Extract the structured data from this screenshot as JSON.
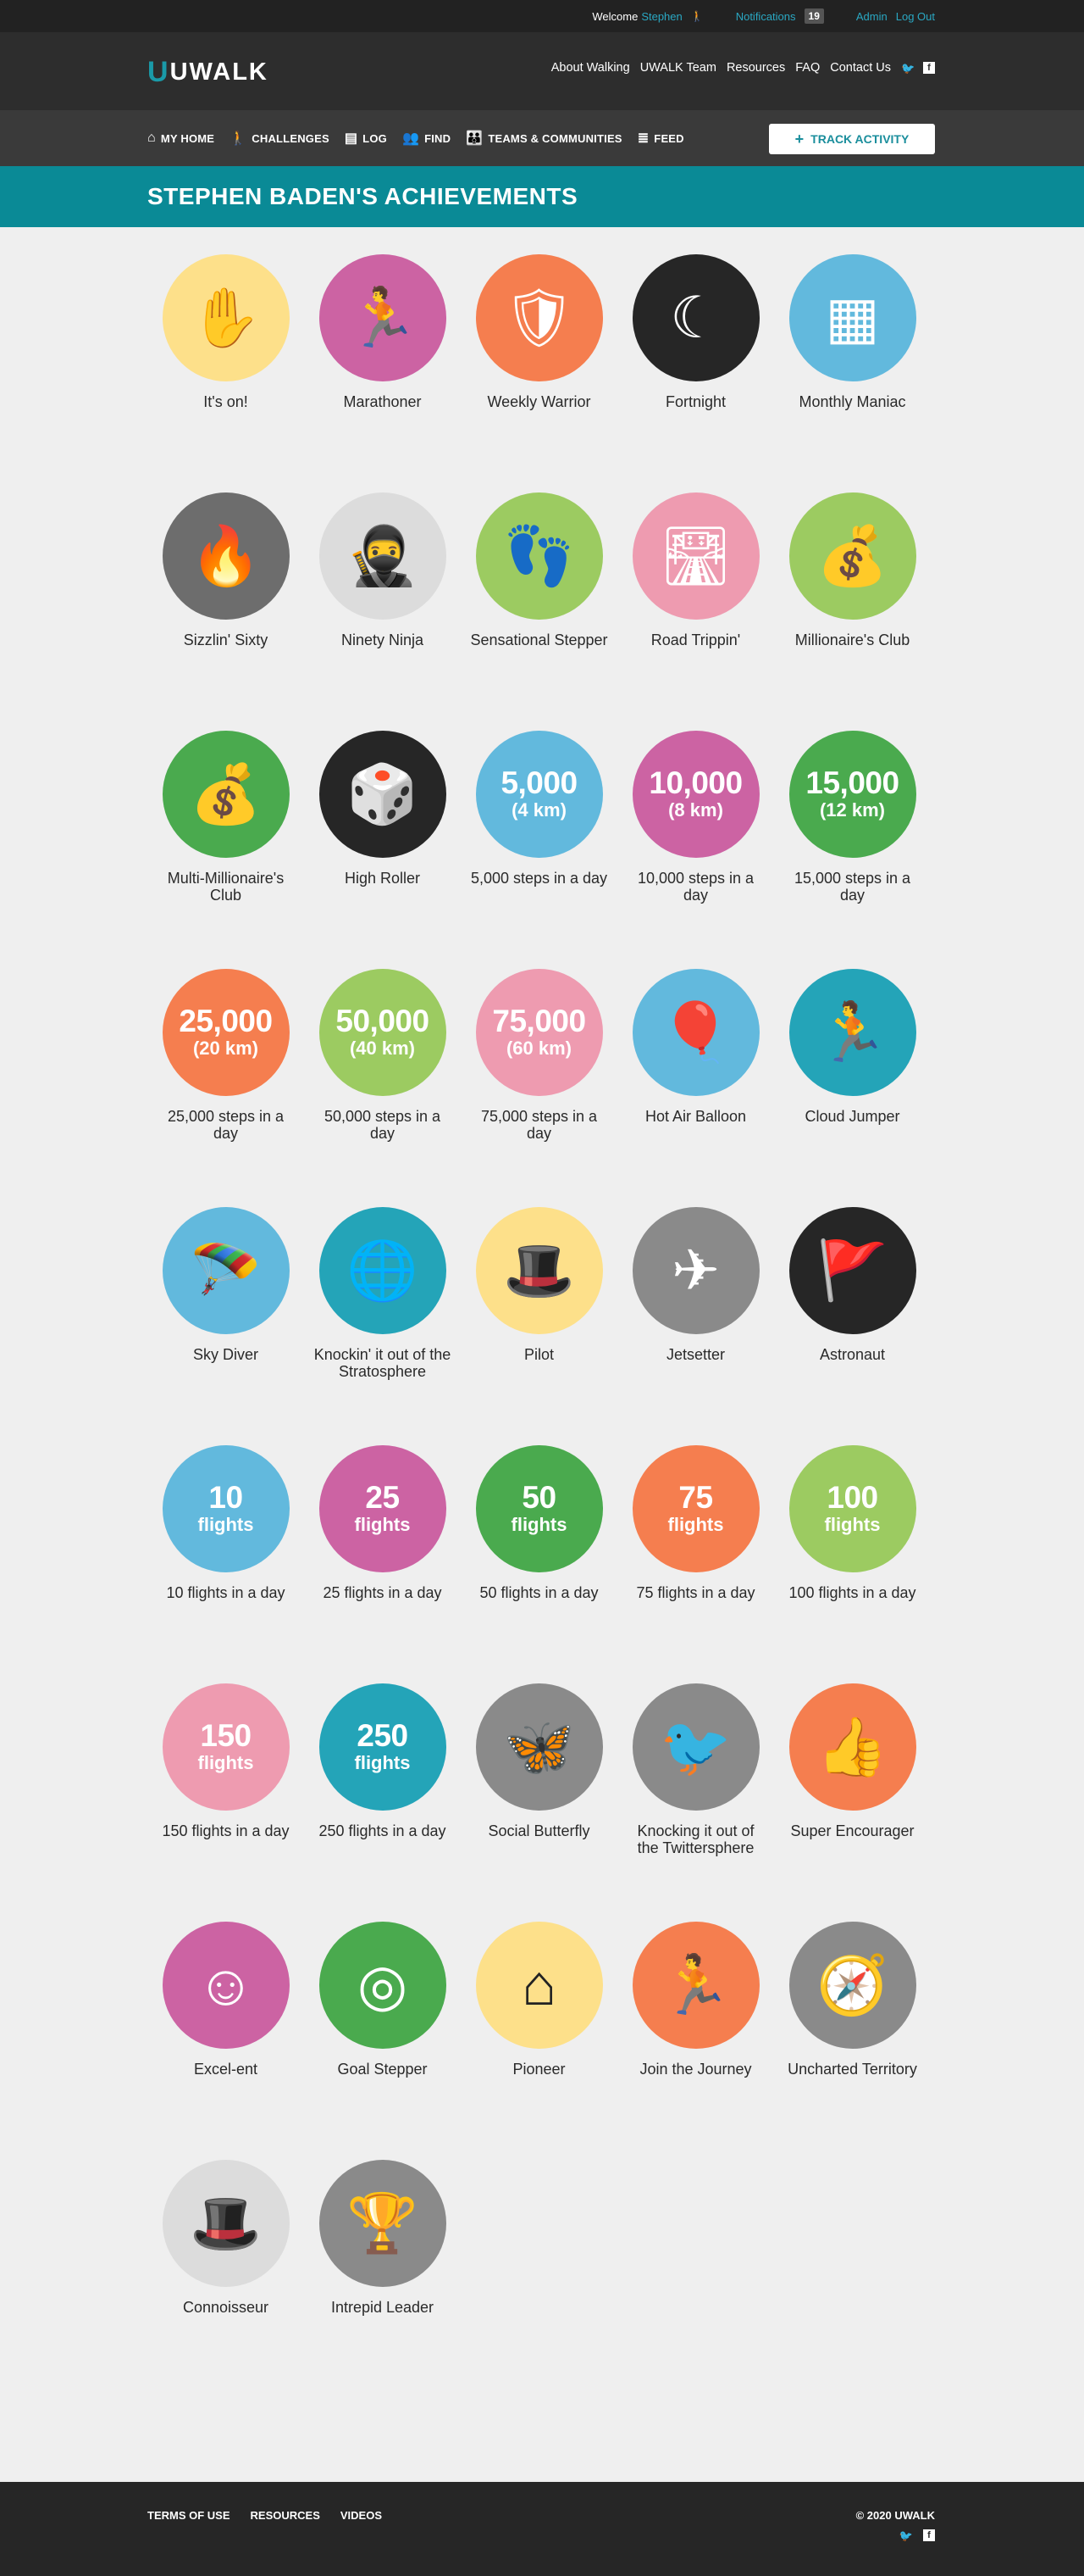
{
  "topbar": {
    "welcome_label": "Welcome",
    "user_name": "Stephen",
    "notifications_label": "Notifications",
    "notifications_count": "19",
    "admin_label": "Admin",
    "logout_label": "Log Out"
  },
  "header": {
    "logo_text": "UWALK",
    "logo_mark": "U",
    "nav": [
      "About Walking",
      "UWALK Team",
      "Resources",
      "FAQ",
      "Contact Us"
    ]
  },
  "mainnav": {
    "items": [
      {
        "label": "MY HOME",
        "icon": "home-icon",
        "glyph": "⌂"
      },
      {
        "label": "CHALLENGES",
        "icon": "walker-icon",
        "glyph": "🚶"
      },
      {
        "label": "LOG",
        "icon": "log-icon",
        "glyph": "▤"
      },
      {
        "label": "FIND",
        "icon": "people-icon",
        "glyph": "👥"
      },
      {
        "label": "TEAMS & COMMUNITIES",
        "icon": "group-icon",
        "glyph": "👪"
      },
      {
        "label": "FEED",
        "icon": "feed-icon",
        "glyph": "≣"
      }
    ],
    "track_button": "TRACK ACTIVITY",
    "track_icon": "+"
  },
  "page_title": "STEPHEN BADEN'S ACHIEVEMENTS",
  "colors": {
    "teal": "#0a8a96",
    "yellow": "#fde08a",
    "pink": "#cc63a3",
    "orange": "#f57e4f",
    "dark": "#262626",
    "blue": "#62b9dd",
    "gray": "#6d6d6d",
    "lightgray": "#dcdcdc",
    "green": "#9ccb61",
    "darkgreen": "#4aaa4e",
    "salmonpink": "#ee9bb0",
    "cyan": "#24a4b8",
    "midgray": "#8a8a8a"
  },
  "achievements": [
    {
      "label": "It's on!",
      "color": "#fde08a",
      "icon": "high-five-icon",
      "glyph": "✋",
      "glyph_color": "#222"
    },
    {
      "label": "Marathoner",
      "color": "#cc63a3",
      "icon": "runner-icon",
      "glyph": "🏃"
    },
    {
      "label": "Weekly Warrior",
      "color": "#f57e4f",
      "icon": "shield-icon",
      "glyph": "🛡"
    },
    {
      "label": "Fortnight",
      "color": "#262626",
      "icon": "moon-icon",
      "glyph": "☾"
    },
    {
      "label": "Monthly Maniac",
      "color": "#62b9dd",
      "icon": "calendar-icon",
      "glyph": "▦"
    },
    {
      "label": "Sizzlin' Sixty",
      "color": "#6d6d6d",
      "icon": "flame-icon",
      "glyph": "🔥"
    },
    {
      "label": "Ninety Ninja",
      "color": "#dcdcdc",
      "icon": "ninja-icon",
      "glyph": "🥷",
      "glyph_color": "#222"
    },
    {
      "label": "Sensational Stepper",
      "color": "#9ccb61",
      "icon": "footprints-icon",
      "glyph": "👣"
    },
    {
      "label": "Road Trippin'",
      "color": "#ee9bb0",
      "icon": "road-icon",
      "glyph": "🛣"
    },
    {
      "label": "Millionaire's Club",
      "color": "#9ccb61",
      "icon": "money-bag-icon",
      "glyph": "💰"
    },
    {
      "label": "Multi-Millionaire's Club",
      "color": "#4aaa4e",
      "icon": "money-bags-icon",
      "glyph": "💰"
    },
    {
      "label": "High Roller",
      "color": "#262626",
      "icon": "dice-icon",
      "glyph": "🎲"
    },
    {
      "label": "5,000 steps in a day",
      "color": "#62b9dd",
      "big": "5,000",
      "small": "(4 km)"
    },
    {
      "label": "10,000 steps in a day",
      "color": "#cc63a3",
      "big": "10,000",
      "small": "(8 km)"
    },
    {
      "label": "15,000 steps in a day",
      "color": "#4aaa4e",
      "big": "15,000",
      "small": "(12 km)"
    },
    {
      "label": "25,000 steps in a day",
      "color": "#f57e4f",
      "big": "25,000",
      "small": "(20 km)"
    },
    {
      "label": "50,000 steps in a day",
      "color": "#9ccb61",
      "big": "50,000",
      "small": "(40 km)"
    },
    {
      "label": "75,000 steps in a day",
      "color": "#ee9bb0",
      "big": "75,000",
      "small": "(60 km)"
    },
    {
      "label": "Hot Air Balloon",
      "color": "#62b9dd",
      "icon": "balloon-icon",
      "glyph": "🎈"
    },
    {
      "label": "Cloud Jumper",
      "color": "#24a4b8",
      "icon": "cloud-jumper-icon",
      "glyph": "🏃"
    },
    {
      "label": "Sky Diver",
      "color": "#62b9dd",
      "icon": "parachute-icon",
      "glyph": "🪂"
    },
    {
      "label": "Knockin' it out of the Stratosphere",
      "color": "#24a4b8",
      "icon": "globe-icon",
      "glyph": "🌐"
    },
    {
      "label": "Pilot",
      "color": "#fde08a",
      "icon": "pilot-hat-icon",
      "glyph": "🎩",
      "glyph_color": "#222"
    },
    {
      "label": "Jetsetter",
      "color": "#8a8a8a",
      "icon": "airplane-icon",
      "glyph": "✈"
    },
    {
      "label": "Astronaut",
      "color": "#262626",
      "icon": "astronaut-icon",
      "glyph": "🚩"
    },
    {
      "label": "10 flights in a day",
      "color": "#62b9dd",
      "big": "10",
      "small": "flights"
    },
    {
      "label": "25 flights in a day",
      "color": "#cc63a3",
      "big": "25",
      "small": "flights"
    },
    {
      "label": "50 flights in a day",
      "color": "#4aaa4e",
      "big": "50",
      "small": "flights"
    },
    {
      "label": "75 flights in a day",
      "color": "#f57e4f",
      "big": "75",
      "small": "flights"
    },
    {
      "label": "100 flights in a day",
      "color": "#9ccb61",
      "big": "100",
      "small": "flights"
    },
    {
      "label": "150 flights in a day",
      "color": "#ee9bb0",
      "big": "150",
      "small": "flights"
    },
    {
      "label": "250 flights in a day",
      "color": "#24a4b8",
      "big": "250",
      "small": "flights"
    },
    {
      "label": "Social Butterfly",
      "color": "#8a8a8a",
      "icon": "butterfly-icon",
      "glyph": "🦋"
    },
    {
      "label": "Knocking it out of the Twittersphere",
      "color": "#8a8a8a",
      "icon": "twitter-bird-icon",
      "glyph": "🐦"
    },
    {
      "label": "Super Encourager",
      "color": "#f57e4f",
      "icon": "thumbs-up-icon",
      "glyph": "👍"
    },
    {
      "label": "Excel-ent",
      "color": "#cc63a3",
      "icon": "smiley-icon",
      "glyph": "☺"
    },
    {
      "label": "Goal Stepper",
      "color": "#4aaa4e",
      "icon": "target-icon",
      "glyph": "◎"
    },
    {
      "label": "Pioneer",
      "color": "#fde08a",
      "icon": "cabin-icon",
      "glyph": "⌂",
      "glyph_color": "#222"
    },
    {
      "label": "Join the Journey",
      "color": "#f57e4f",
      "icon": "runner-path-icon",
      "glyph": "🏃"
    },
    {
      "label": "Uncharted Territory",
      "color": "#8a8a8a",
      "icon": "compass-icon",
      "glyph": "🧭"
    },
    {
      "label": "Connoisseur",
      "color": "#dcdcdc",
      "icon": "bowler-mustache-icon",
      "glyph": "🎩",
      "glyph_color": "#222"
    },
    {
      "label": "Intrepid Leader",
      "color": "#8a8a8a",
      "icon": "trophy-icon",
      "glyph": "🏆"
    }
  ],
  "footer": {
    "links": [
      "TERMS OF USE",
      "RESOURCES",
      "VIDEOS"
    ],
    "copyright": "© 2020 UWALK"
  }
}
